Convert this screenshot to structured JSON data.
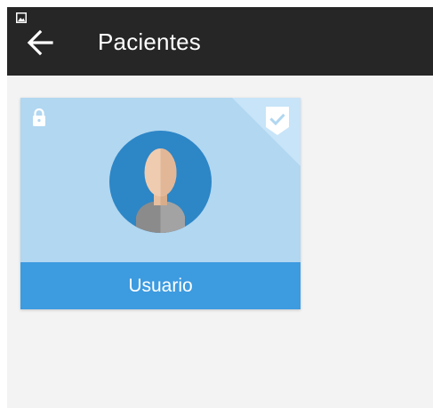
{
  "toolbar": {
    "title": "Pacientes",
    "back_icon": "arrow-left-icon",
    "status_icon": "image-icon"
  },
  "patients": [
    {
      "name": "Usuario",
      "locked": true,
      "selected": true,
      "icons": {
        "lock": "lock-icon",
        "badge": "check-badge-icon",
        "avatar": "person-avatar-icon"
      }
    }
  ],
  "colors": {
    "toolbar_bg": "#262626",
    "screen_bg": "#f3f3f3",
    "card_bg": "#b1d7f1",
    "card_footer": "#3d9be0",
    "avatar_circle": "#2d86c6",
    "text_light": "#ffffff"
  }
}
